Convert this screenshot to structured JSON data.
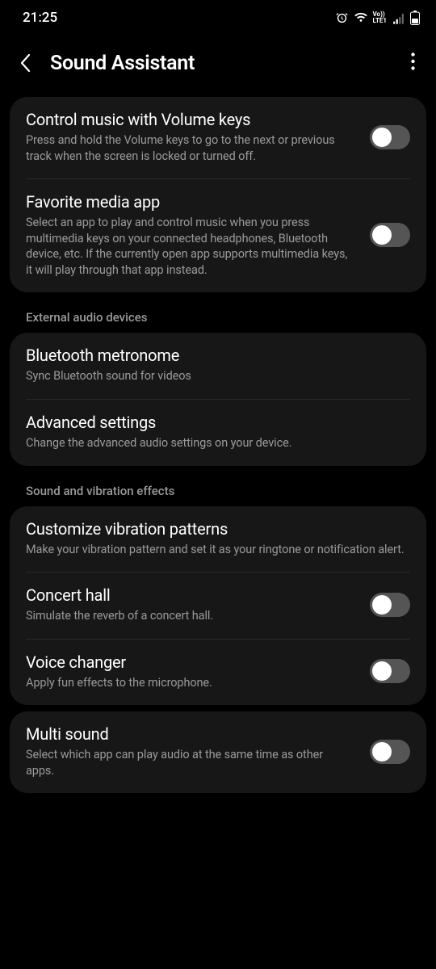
{
  "status": {
    "time": "21:25",
    "lte_label": "LTE1"
  },
  "header": {
    "title": "Sound Assistant"
  },
  "items": {
    "vol_keys": {
      "title": "Control music with Volume keys",
      "desc": "Press and hold the Volume keys to go to the next or previous track when the screen is locked or turned off."
    },
    "fav_media": {
      "title": "Favorite media app",
      "desc": "Select an app to play and control music when you press multimedia keys on your connected headphones, Bluetooth device, etc. If the currently open app supports multimedia keys, it will play through that app instead."
    },
    "bt_metro": {
      "title": "Bluetooth metronome",
      "desc": "Sync Bluetooth sound for videos"
    },
    "adv": {
      "title": "Advanced settings",
      "desc": "Change the advanced audio settings on your device."
    },
    "vib": {
      "title": "Customize vibration patterns",
      "desc": "Make your vibration pattern and set it as your ringtone or notification alert."
    },
    "concert": {
      "title": "Concert hall",
      "desc": "Simulate the reverb of a concert hall."
    },
    "voice": {
      "title": "Voice changer",
      "desc": "Apply fun effects to the microphone."
    },
    "multi": {
      "title": "Multi sound",
      "desc": "Select which app can play audio at the same time as other apps."
    }
  },
  "sections": {
    "external": "External audio devices",
    "effects": "Sound and vibration effects"
  }
}
